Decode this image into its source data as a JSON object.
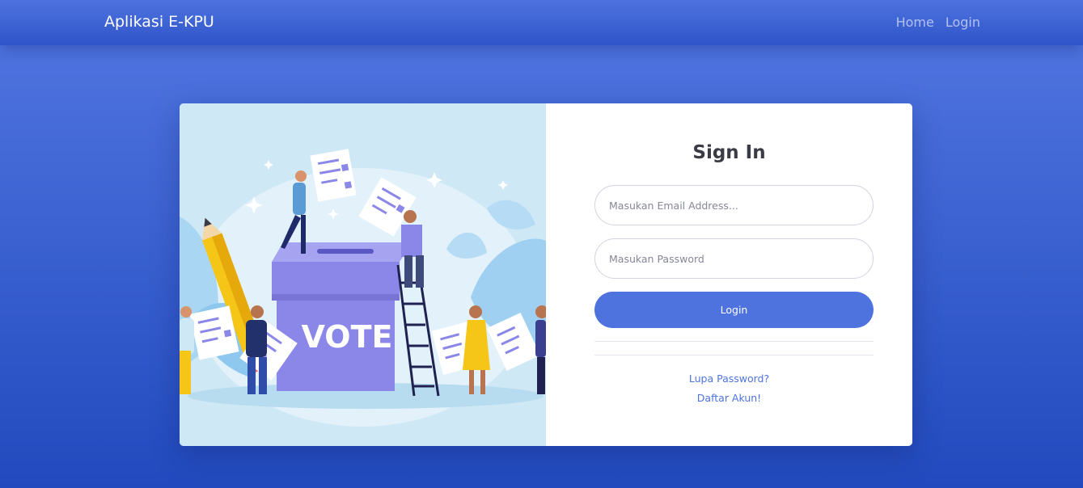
{
  "navbar": {
    "brand": "Aplikasi E-KPU",
    "links": [
      "Home",
      "Login"
    ]
  },
  "illustration": {
    "vote_text": "VOTE"
  },
  "form": {
    "title": "Sign In",
    "email_placeholder": "Masukan Email Address...",
    "password_placeholder": "Masukan Password",
    "login_label": "Login",
    "forgot_link": "Lupa Password?",
    "register_link": "Daftar Akun!"
  },
  "colors": {
    "primary": "#4e73df",
    "background_dark": "#224abe",
    "illustration_bg": "#cfe8f6",
    "ballot_box": "#8a87e8"
  }
}
